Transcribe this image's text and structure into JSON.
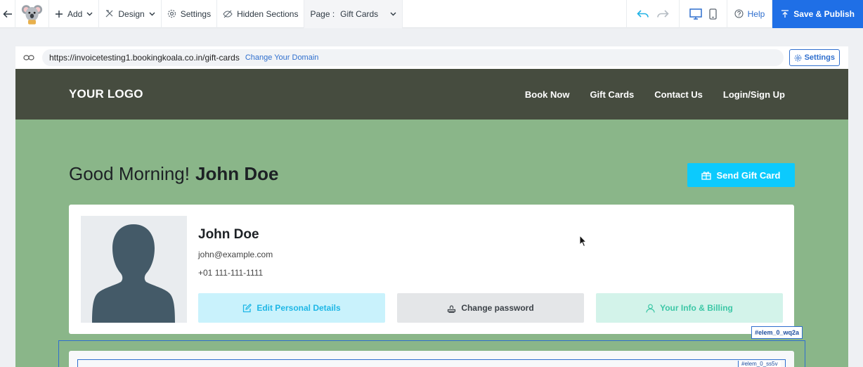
{
  "toolbar": {
    "add_label": "Add",
    "design_label": "Design",
    "settings_label": "Settings",
    "hidden_sections_label": "Hidden Sections",
    "page_prefix": "Page :",
    "page_value": "Gift Cards",
    "help_label": "Help",
    "publish_label": "Save & Publish"
  },
  "urlbar": {
    "url": "https://invoicetesting1.bookingkoala.co.in/gift-cards",
    "change_domain_label": "Change Your Domain",
    "settings_label": "Settings"
  },
  "site_header": {
    "logo": "YOUR LOGO",
    "nav": [
      "Book Now",
      "Gift Cards",
      "Contact Us",
      "Login/Sign Up"
    ]
  },
  "page": {
    "greeting": "Good Morning!",
    "user_name": "John Doe",
    "send_gift_label": "Send Gift Card"
  },
  "profile": {
    "name": "John Doe",
    "email": "john@example.com",
    "phone": "+01 111-111-1111",
    "edit_label": "Edit Personal Details",
    "password_label": "Change password",
    "info_label": "Your Info & Billing"
  },
  "element_tags": {
    "primary": "#elem_0_wq2a",
    "secondary": "#elem_0_ss5v"
  },
  "colors": {
    "publish": "#1f6fe6",
    "header_bg": "#464c3f",
    "page_bg": "#8ab689",
    "send_button": "#0ccafd"
  }
}
